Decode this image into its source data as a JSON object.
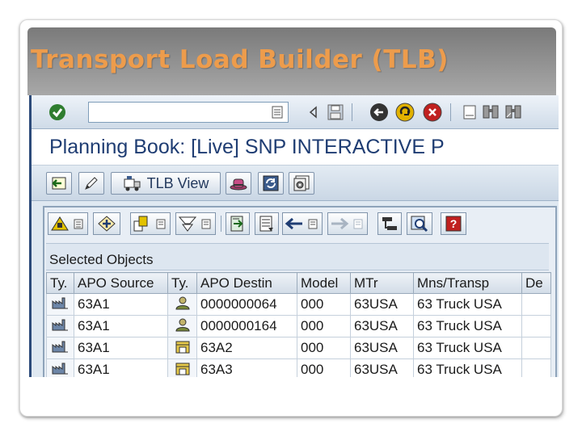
{
  "slide": {
    "title": "Transport Load Builder (TLB)"
  },
  "sap": {
    "planning_title": "Planning Book: [Live] SNP INTERACTIVE P",
    "tlb_view_label": "TLB View",
    "selected_objects_label": "Selected Objects",
    "columns": [
      "Ty.",
      "APO Source",
      "Ty.",
      "APO Destin",
      "Model",
      "MTr",
      "Mns/Transp",
      "De"
    ],
    "rows": [
      {
        "src_type_icon": "factory-icon",
        "source": "63A1",
        "dst_type_icon": "person-icon",
        "destination": "0000000064",
        "model": "000",
        "mtr": "63USA",
        "means": "63 Truck USA"
      },
      {
        "src_type_icon": "factory-icon",
        "source": "63A1",
        "dst_type_icon": "person-icon",
        "destination": "0000000164",
        "model": "000",
        "mtr": "63USA",
        "means": "63 Truck USA"
      },
      {
        "src_type_icon": "factory-icon",
        "source": "63A1",
        "dst_type_icon": "warehouse-icon",
        "destination": "63A2",
        "model": "000",
        "mtr": "63USA",
        "means": "63 Truck USA"
      },
      {
        "src_type_icon": "factory-icon",
        "source": "63A1",
        "dst_type_icon": "warehouse-icon",
        "destination": "63A3",
        "model": "000",
        "mtr": "63USA",
        "means": "63 Truck USA"
      }
    ]
  },
  "colors": {
    "title_orange": "#ed9c4c",
    "sap_blue": "#1f3d73"
  }
}
